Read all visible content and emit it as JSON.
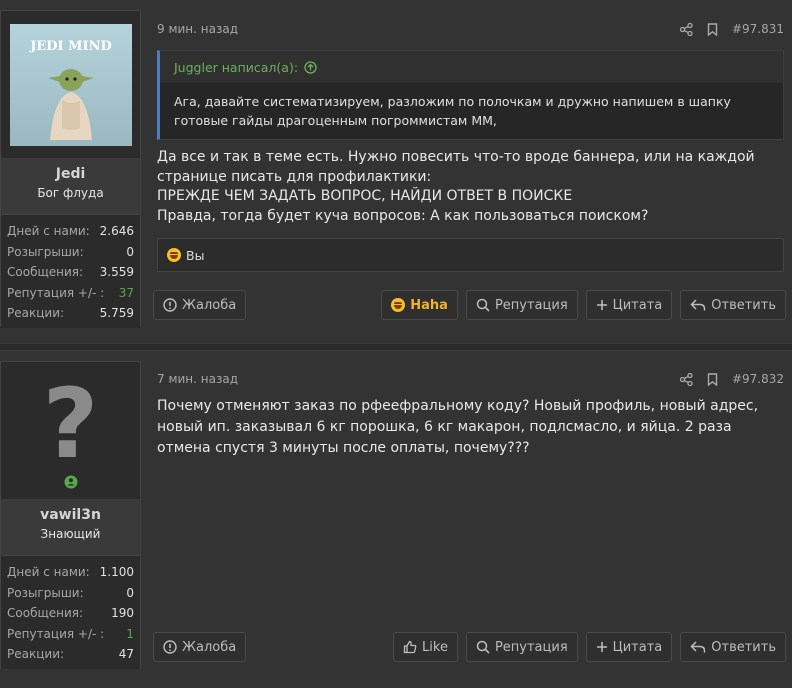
{
  "posts": [
    {
      "username": "Jedi",
      "user_title": "Бог флуда",
      "avatar_label": "JEDI MIND",
      "stats": [
        {
          "key": "Дней с нами:",
          "value": "2.646"
        },
        {
          "key": "Розыгрыши:",
          "value": "0"
        },
        {
          "key": "Сообщения:",
          "value": "3.559"
        },
        {
          "key": "Репутация +/- :",
          "value": "37"
        },
        {
          "key": "Реакции:",
          "value": "5.759"
        }
      ],
      "time": "9 мин. назад",
      "post_number": "#97.831",
      "quote_author": "Juggler написал(а):",
      "quote_text": "Ага, давайте систематизируем, разложим по полочкам и дружно напишем в шапку готовые гайды драгоценным погроммистам ММ,",
      "message_lines": [
        "Да все и так в теме есть. Нужно повесить что-то вроде баннера, или на каждой странице писать для профилактики:",
        "ПРЕЖДЕ ЧЕМ ЗАДАТЬ ВОПРОС, НАЙДИ ОТВЕТ В ПОИСКЕ",
        "Правда, тогда будет куча вопросов: А как пользоваться поиском?"
      ],
      "reaction_text": "Вы",
      "buttons": {
        "report": "Жалоба",
        "react": "Haha",
        "reputation": "Репутация",
        "quote": "Цитата",
        "reply": "Ответить"
      }
    },
    {
      "username": "vawil3n",
      "user_title": "Знающий",
      "avatar_label": "?",
      "stats": [
        {
          "key": "Дней с нами:",
          "value": "1.100"
        },
        {
          "key": "Розыгрыши:",
          "value": "0"
        },
        {
          "key": "Сообщения:",
          "value": "190"
        },
        {
          "key": "Репутация +/- :",
          "value": "1"
        },
        {
          "key": "Реакции:",
          "value": "47"
        }
      ],
      "time": "7 мин. назад",
      "post_number": "#97.832",
      "message_lines": [
        "Почему отменяют заказ по рфеефральному коду? Новый профиль, новый адрес, новый ип. заказывал 6 кг порошка, 6 кг макарон, подлсмасло, и яйца. 2 раза отмена спустя 3 минуты после оплаты, почему???"
      ],
      "buttons": {
        "report": "Жалоба",
        "react": "Like",
        "reputation": "Репутация",
        "quote": "Цитата",
        "reply": "Ответить"
      }
    }
  ],
  "colors": {
    "accent_quote": "#4a7ec2",
    "quote_author": "#6db05c",
    "reputation_positive": "#5aa64a",
    "haha": "#f0b429"
  }
}
